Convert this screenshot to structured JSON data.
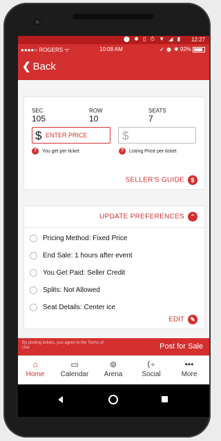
{
  "android_status": {
    "time": "12:27",
    "icons": "⬤ ✱ ▯ ⏱ ▼ ◢ ▮"
  },
  "ios_status": {
    "carrier": "●●●●○ ROGERS ᯤ",
    "time": "10:08 AM",
    "battery": "➶ ⏰ ✱ 92%"
  },
  "nav": {
    "back_label": "Back"
  },
  "listing": {
    "sec_label": "SEC",
    "sec_value": "105",
    "row_label": "ROW",
    "row_value": "10",
    "seats_label": "SEATS",
    "seats_value": "7",
    "currency": "$",
    "price_placeholder": "ENTER PRICE",
    "price_hint": "You get per ticket",
    "listing_placeholder": "",
    "listing_hint": "Listing Price per ticket",
    "sellers_guide": "SELLER'S GUIDE"
  },
  "preferences": {
    "update_label": "UPDATE PREFERENCES",
    "items": [
      {
        "label": "Pricing Method:",
        "value": "Fixed Price"
      },
      {
        "label": "End Sale:",
        "value": "1 hours after event"
      },
      {
        "label": "You Get Paid:",
        "value": "Seller Credit"
      },
      {
        "label": "Splits:",
        "value": "Not Allowed"
      },
      {
        "label": "Seat Details:",
        "value": "Center ice"
      }
    ],
    "edit_label": "EDIT"
  },
  "post": {
    "terms": "By posting tickets, you agree to the Terms of Use",
    "button": "Post for Sale"
  },
  "tabs": [
    {
      "label": "Home",
      "icon": "home-icon",
      "active": true
    },
    {
      "label": "Calendar",
      "icon": "calendar-icon",
      "active": false
    },
    {
      "label": "Arena",
      "icon": "arena-icon",
      "active": false
    },
    {
      "label": "Social",
      "icon": "share-icon",
      "active": false
    },
    {
      "label": "More",
      "icon": "more-icon",
      "active": false
    }
  ],
  "colors": {
    "accent": "#d32f2f",
    "background": "#f4f4f4"
  }
}
